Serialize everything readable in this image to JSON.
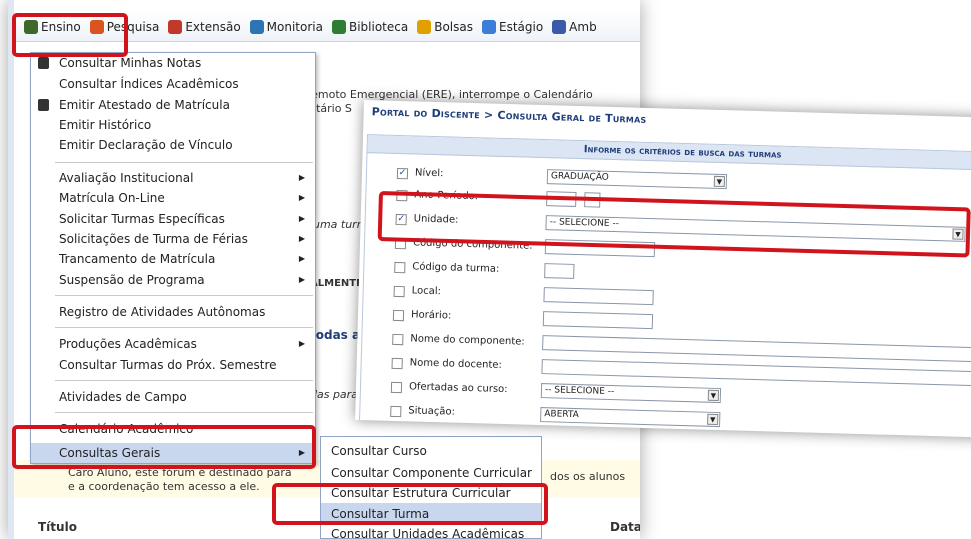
{
  "menubar": {
    "items": [
      {
        "label": "Ensino",
        "icon": "ensino-icon",
        "color": "#3d6a2b"
      },
      {
        "label": "Pesquisa",
        "icon": "pesquisa-icon",
        "color": "#d9541e"
      },
      {
        "label": "Extensão",
        "icon": "extensao-icon",
        "color": "#c0392b"
      },
      {
        "label": "Monitoria",
        "icon": "monitoria-icon",
        "color": "#2c74b3"
      },
      {
        "label": "Biblioteca",
        "icon": "biblioteca-icon",
        "color": "#2e7d32"
      },
      {
        "label": "Bolsas",
        "icon": "bolsas-icon",
        "color": "#e0a100"
      },
      {
        "label": "Estágio",
        "icon": "estagio-icon",
        "color": "#3b7dd8"
      },
      {
        "label": "Amb",
        "icon": "ambiente-icon",
        "color": "#3b5aa8"
      }
    ]
  },
  "background": {
    "notice_line1": "Remoto Emergencial (ERE), interrompe o Calendário",
    "notice_line2": "ersitário S",
    "turma_text": "huma turm",
    "almente": "ALMENTE",
    "n_letter": "N",
    "todas": "todas as",
    "das_para": "das para o",
    "dos_alunos": "dos os alunos",
    "forum_line1": "Caro Aluno, este fórum é destinado para",
    "forum_line2": "e a coordenação tem acesso a ele.",
    "col_titulo": "Título",
    "col_data": "Data"
  },
  "menu": {
    "items": [
      {
        "label": "Consultar Minhas Notas",
        "has_icon": true
      },
      {
        "label": "Consultar Índices Acadêmicos"
      },
      {
        "label": "Emitir Atestado de Matrícula",
        "has_icon": true
      },
      {
        "label": "Emitir Histórico"
      },
      {
        "label": "Emitir Declaração de Vínculo"
      },
      {
        "label": "Avaliação Institucional",
        "submenu": true
      },
      {
        "label": "Matrícula On-Line",
        "submenu": true
      },
      {
        "label": "Solicitar Turmas Específicas",
        "submenu": true
      },
      {
        "label": "Solicitações de Turma de Férias",
        "submenu": true
      },
      {
        "label": "Trancamento de Matrícula",
        "submenu": true
      },
      {
        "label": "Suspensão de Programa",
        "submenu": true
      },
      {
        "label": "Registro de Atividades Autônomas"
      },
      {
        "label": "Produções Acadêmicas",
        "submenu": true
      },
      {
        "label": "Consultar Turmas do Próx. Semestre"
      },
      {
        "label": "Atividades de Campo"
      },
      {
        "label": "Calendário Acadêmico"
      },
      {
        "label": "Consultas Gerais",
        "submenu": true,
        "selected": true
      }
    ]
  },
  "submenu": {
    "items": [
      {
        "label": "Consultar Curso"
      },
      {
        "label": "Consultar Componente Curricular"
      },
      {
        "label": "Consultar Estrutura Curricular"
      },
      {
        "label": "Consultar Turma",
        "selected": true
      },
      {
        "label": "Consultar Unidades Acadêmicas"
      }
    ]
  },
  "form": {
    "breadcrumb": "Portal do Discente > Consulta Geral de Turmas",
    "header": "Informe os critérios de busca das turmas",
    "rows": [
      {
        "label": "Nível:",
        "checked": true,
        "value": "GRADUAÇÃO",
        "kind": "select"
      },
      {
        "label": "Ano-Período:",
        "checked": false,
        "value": "",
        "kind": "period"
      },
      {
        "label": "Unidade:",
        "checked": true,
        "value": "-- SELECIONE --",
        "kind": "select"
      },
      {
        "label": "Código do componente:",
        "checked": false,
        "value": "",
        "kind": "text"
      },
      {
        "label": "Código da turma:",
        "checked": false,
        "value": "",
        "kind": "text"
      },
      {
        "label": "Local:",
        "checked": false,
        "value": "",
        "kind": "text"
      },
      {
        "label": "Horário:",
        "checked": false,
        "value": "",
        "kind": "text"
      },
      {
        "label": "Nome do componente:",
        "checked": false,
        "value": "",
        "kind": "text"
      },
      {
        "label": "Nome do docente:",
        "checked": false,
        "value": "",
        "kind": "text"
      },
      {
        "label": "Ofertadas ao curso:",
        "checked": false,
        "value": "-- SELECIONE --",
        "kind": "select"
      },
      {
        "label": "Situação:",
        "checked": false,
        "value": "ABERTA",
        "kind": "select"
      }
    ]
  },
  "highlight_color": "#d1141b"
}
